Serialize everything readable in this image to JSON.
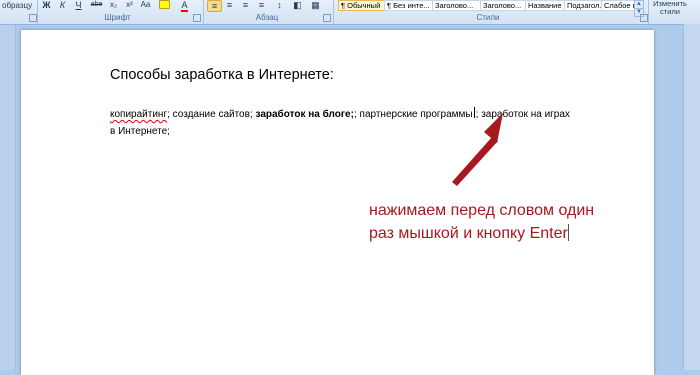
{
  "ribbon": {
    "clipboard": {
      "format_painter_label": "образцу"
    },
    "font": {
      "group_label": "Шрифт",
      "buttons": [
        "Ж",
        "К",
        "Ч",
        "abe",
        "x₂",
        "x²",
        "Aa",
        "ab",
        "A"
      ]
    },
    "paragraph": {
      "group_label": "Абзац",
      "buttons": [
        "≡",
        "≡",
        "≡",
        "≡",
        "↕",
        "◧",
        "▦"
      ]
    },
    "styles": {
      "group_label": "Стили",
      "tiles": [
        "¶ Обычный",
        "¶ Без инте...",
        "Заголово...",
        "Заголово...",
        "Название",
        "Подзагол...",
        "Слабое в..."
      ],
      "change_styles_label": "Изменить стили"
    },
    "accent_colors": {
      "highlight": "#ffff00",
      "font_color": "#ff0000"
    }
  },
  "document": {
    "title": "Способы заработка  в Интернете:",
    "line1": {
      "part1": "копирайтинг",
      "part2": ";  создание сайтов; ",
      "part3": "заработок на блоге",
      "part4": "; партнерские программы",
      "part5": "; ",
      "part6": "заработок на играх"
    },
    "line2": "в Интернете;"
  },
  "annotation": {
    "line1": "нажимаем перед словом один",
    "line2": "раз мышкой и кнопку Enter",
    "color": "#a8181e"
  }
}
